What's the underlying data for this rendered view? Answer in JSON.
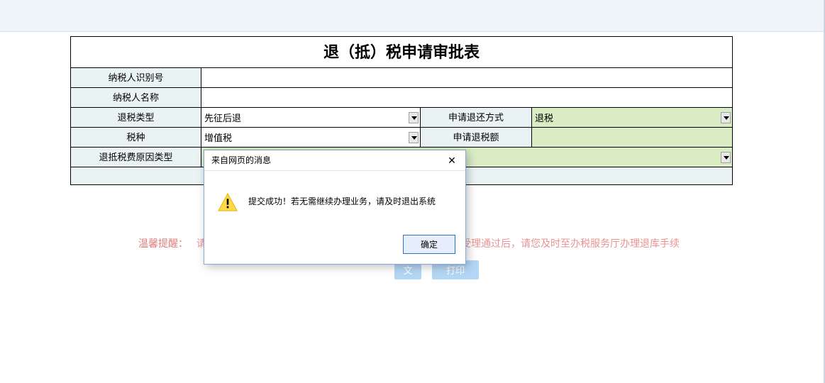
{
  "title": "退（抵）税申请审批表",
  "rows": {
    "r1": {
      "label": "纳税人识别号",
      "value": ""
    },
    "r2": {
      "label": "纳税人名称",
      "value": ""
    },
    "r3": {
      "labelL": "退税类型",
      "valueL": "先征后退",
      "labelR": "申请退还方式",
      "valueR": "退税"
    },
    "r4": {
      "labelL": "税种",
      "valueL": "增值税",
      "labelR": "申请退税额",
      "valueR": ""
    },
    "r5": {
      "label": "退抵税费原因类型",
      "value": ""
    }
  },
  "hint": {
    "label": "温馨提醒：",
    "textLeft": "请您",
    "textRight": "受理通过后，请您及时至办税服务厅办理退库手续"
  },
  "buttons": {
    "b1": "文",
    "b2": "打印"
  },
  "dialog": {
    "title": "来自网页的消息",
    "message": "提交成功！若无需继续办理业务，请及时退出系统",
    "ok": "确定"
  }
}
